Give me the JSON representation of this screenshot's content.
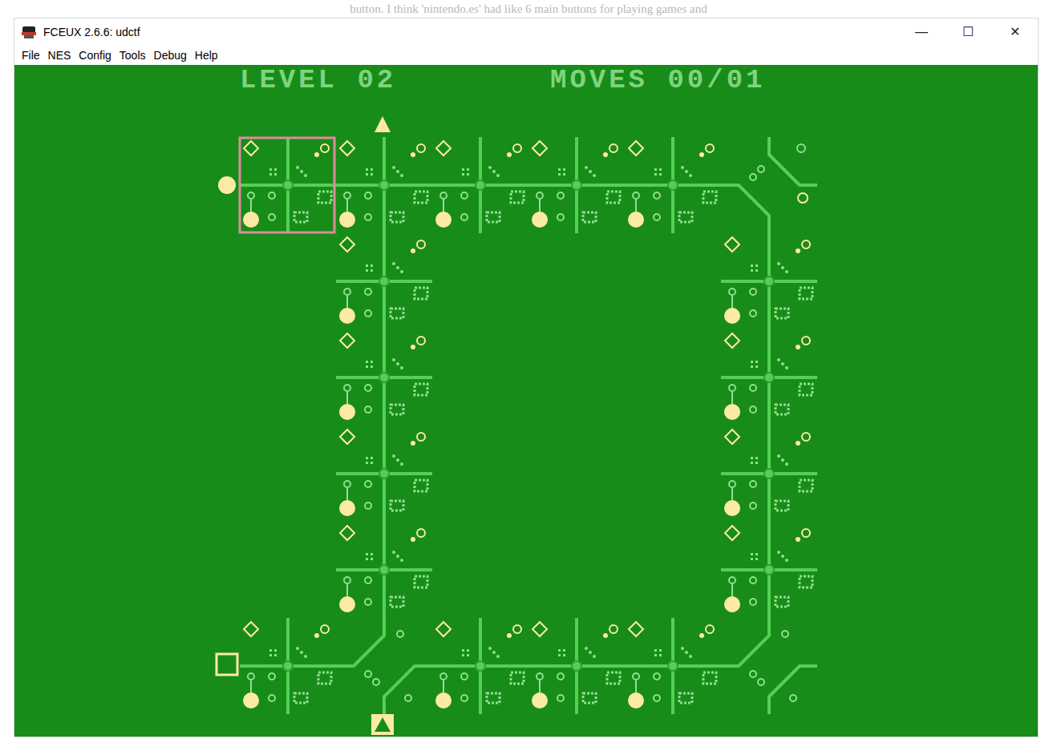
{
  "caption": "button. I think 'nintendo.es' had like 6 main buttons for playing games and",
  "window": {
    "title": "FCEUX 2.6.6: udctf",
    "controls": [
      "—",
      "☐",
      "✕"
    ]
  },
  "menu": [
    "File",
    "NES",
    "Config",
    "Tools",
    "Debug",
    "Help"
  ],
  "game": {
    "level_label": "LEVEL 02",
    "moves_label": "MOVES 00/01",
    "grid": [
      [
        {
          "kind": "cross",
          "selected": true
        },
        {
          "kind": "cross",
          "selected": false
        },
        {
          "kind": "cross",
          "selected": false
        },
        {
          "kind": "cross",
          "selected": false
        },
        {
          "kind": "cross",
          "selected": false
        },
        {
          "kind": "curve-b",
          "selected": false
        }
      ],
      [
        {
          "kind": "empty",
          "selected": false
        },
        {
          "kind": "cross",
          "selected": false
        },
        {
          "kind": "empty",
          "selected": false
        },
        {
          "kind": "empty",
          "selected": false
        },
        {
          "kind": "empty",
          "selected": false
        },
        {
          "kind": "cross",
          "selected": false
        }
      ],
      [
        {
          "kind": "empty",
          "selected": false
        },
        {
          "kind": "cross",
          "selected": false
        },
        {
          "kind": "empty",
          "selected": false
        },
        {
          "kind": "empty",
          "selected": false
        },
        {
          "kind": "empty",
          "selected": false
        },
        {
          "kind": "cross",
          "selected": false
        }
      ],
      [
        {
          "kind": "empty",
          "selected": false
        },
        {
          "kind": "cross",
          "selected": false
        },
        {
          "kind": "empty",
          "selected": false
        },
        {
          "kind": "empty",
          "selected": false
        },
        {
          "kind": "empty",
          "selected": false
        },
        {
          "kind": "cross",
          "selected": false
        }
      ],
      [
        {
          "kind": "empty",
          "selected": false
        },
        {
          "kind": "cross",
          "selected": false
        },
        {
          "kind": "empty",
          "selected": false
        },
        {
          "kind": "empty",
          "selected": false
        },
        {
          "kind": "empty",
          "selected": false
        },
        {
          "kind": "cross",
          "selected": false
        }
      ],
      [
        {
          "kind": "cross",
          "selected": false
        },
        {
          "kind": "curve-a",
          "selected": false
        },
        {
          "kind": "cross",
          "selected": false
        },
        {
          "kind": "cross",
          "selected": false
        },
        {
          "kind": "cross",
          "selected": false
        },
        {
          "kind": "curve-a",
          "selected": false
        }
      ]
    ]
  }
}
